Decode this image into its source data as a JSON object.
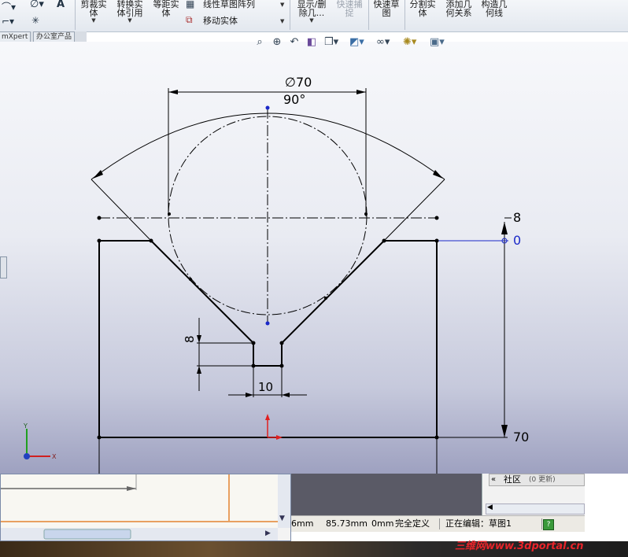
{
  "ribbon": {
    "col1_line1": "剪裁实",
    "col1_line2": "体",
    "col2_line1": "转换实",
    "col2_line2": "体引用",
    "col3_line1": "等距实",
    "col3_line2": "体",
    "linear_pattern": "线性草图阵列",
    "move_entities": "移动实体",
    "display_delete_line1": "显示/删",
    "display_delete_line2": "除几...",
    "quick_snap_line1": "快速捕",
    "quick_snap_line2": "捉",
    "rapid_sketch_line1": "快速草",
    "rapid_sketch_line2": "图",
    "split_line1": "分割实",
    "split_line2": "体",
    "add_relation_line1": "添加几",
    "add_relation_line2": "何关系",
    "construction_line1": "构造几",
    "construction_line2": "何线"
  },
  "tabs": [
    "mXpert",
    "办公室产品"
  ],
  "dimensions": {
    "diameter": "∅70",
    "angle": "90°",
    "right_top": "8",
    "right_zero": "0",
    "right_bottom": "70",
    "slot_width": "10",
    "slot_depth": "8"
  },
  "taskpane": {
    "community": "社区",
    "updates": "(0 更新)"
  },
  "status": {
    "val1": "6mm",
    "val2": "85.73mm",
    "val3": "0mm",
    "defined": "完全定义",
    "editing": "正在编辑：草图1",
    "help": "?"
  },
  "watermark": "三维网www.3dportal.cn",
  "colors": {
    "sketch_line": "#000000",
    "dimension_blue": "#1a28c8",
    "origin_red": "#e02020",
    "accent": "#3a6ea5"
  }
}
